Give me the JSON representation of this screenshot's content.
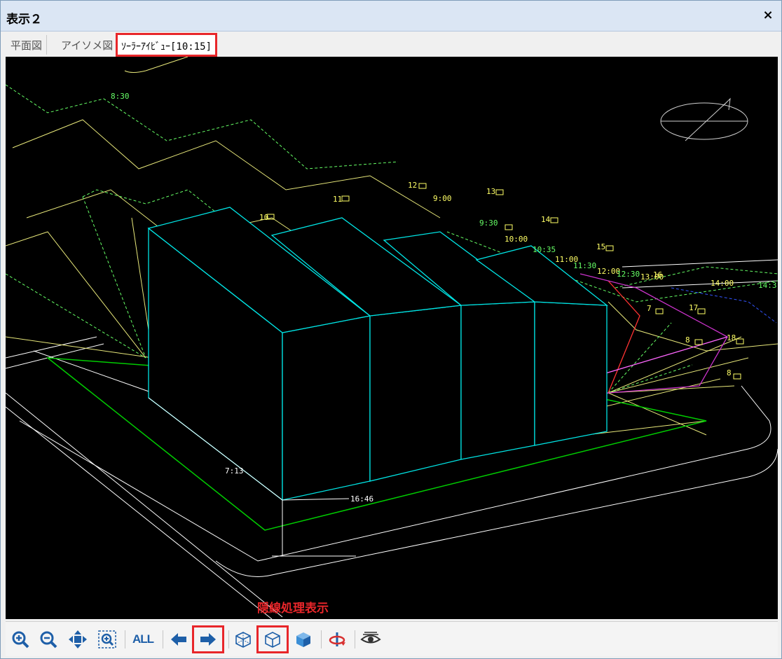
{
  "window": {
    "title": "表示２",
    "close_label": "×"
  },
  "tabs": [
    {
      "label": "平面図"
    },
    {
      "label": "アイソメ図"
    },
    {
      "label": "ｿｰﾗｰｱｲﾋﾞｭｰ[10:15]",
      "active": true
    }
  ],
  "viewport": {
    "time_labels": [
      "8:30",
      "9:00",
      "9:30",
      "10:00",
      "10:35",
      "11:00",
      "11:30",
      "12:00",
      "12:30",
      "13:00",
      "14:00",
      "14:3",
      "7:13",
      "16:46"
    ],
    "hour_markers": [
      "10",
      "11",
      "12",
      "13",
      "14",
      "15",
      "16",
      "17",
      "18",
      "7",
      "8",
      "8"
    ]
  },
  "toolbar": {
    "all_label": "ALL",
    "callout": "隠線処理表示",
    "buttons": [
      {
        "icon": "zoom-in-icon"
      },
      {
        "icon": "zoom-out-icon"
      },
      {
        "icon": "pan-icon"
      },
      {
        "icon": "zoom-window-icon"
      },
      {
        "icon": "zoom-all-icon"
      },
      {
        "icon": "arrow-left-icon"
      },
      {
        "icon": "arrow-right-icon"
      },
      {
        "icon": "wireframe-box-icon"
      },
      {
        "icon": "hidden-line-box-icon"
      },
      {
        "icon": "shaded-box-icon"
      },
      {
        "icon": "rotate-icon"
      },
      {
        "icon": "eye-icon"
      }
    ]
  },
  "colors": {
    "accent_highlight": "#e8262a",
    "building_edge": "#00e5e5",
    "site_line": "#ffff66",
    "shadow_dashed": "#66ff66",
    "boundary_green": "#00cc00",
    "magenta": "#ff00ff"
  }
}
